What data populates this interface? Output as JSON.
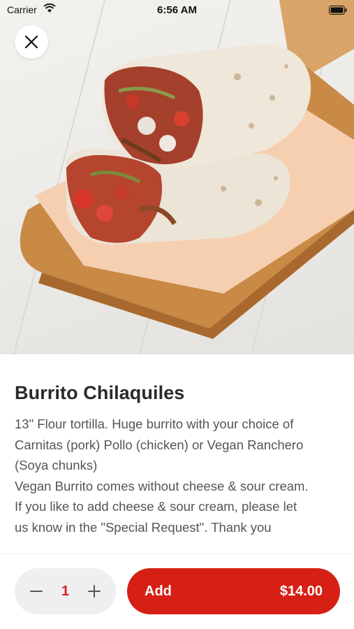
{
  "status_bar": {
    "carrier": "Carrier",
    "time": "6:56 AM"
  },
  "hero": {
    "image": "burrito-photo"
  },
  "icons": {
    "close": "close-icon",
    "wifi": "wifi-icon",
    "battery": "battery-icon",
    "minus": "minus-icon",
    "plus": "plus-icon"
  },
  "item": {
    "title": "Burrito Chilaquiles",
    "description_lines": [
      "13\" Flour tortilla. Huge burrito with your choice of",
      "Carnitas (pork) Pollo (chicken) or Vegan Ranchero",
      "(Soya chunks)",
      "Vegan Burrito comes without cheese & sour cream.",
      "If you like to add cheese & sour cream, please let",
      "us know in the \"Special Request\". Thank you"
    ]
  },
  "order": {
    "quantity": "1",
    "add_label": "Add",
    "price": "$14.00"
  },
  "colors": {
    "accent": "#d62015",
    "stepper_bg": "#efefef",
    "title_text": "#2a2a2a",
    "body_text": "#555555"
  }
}
